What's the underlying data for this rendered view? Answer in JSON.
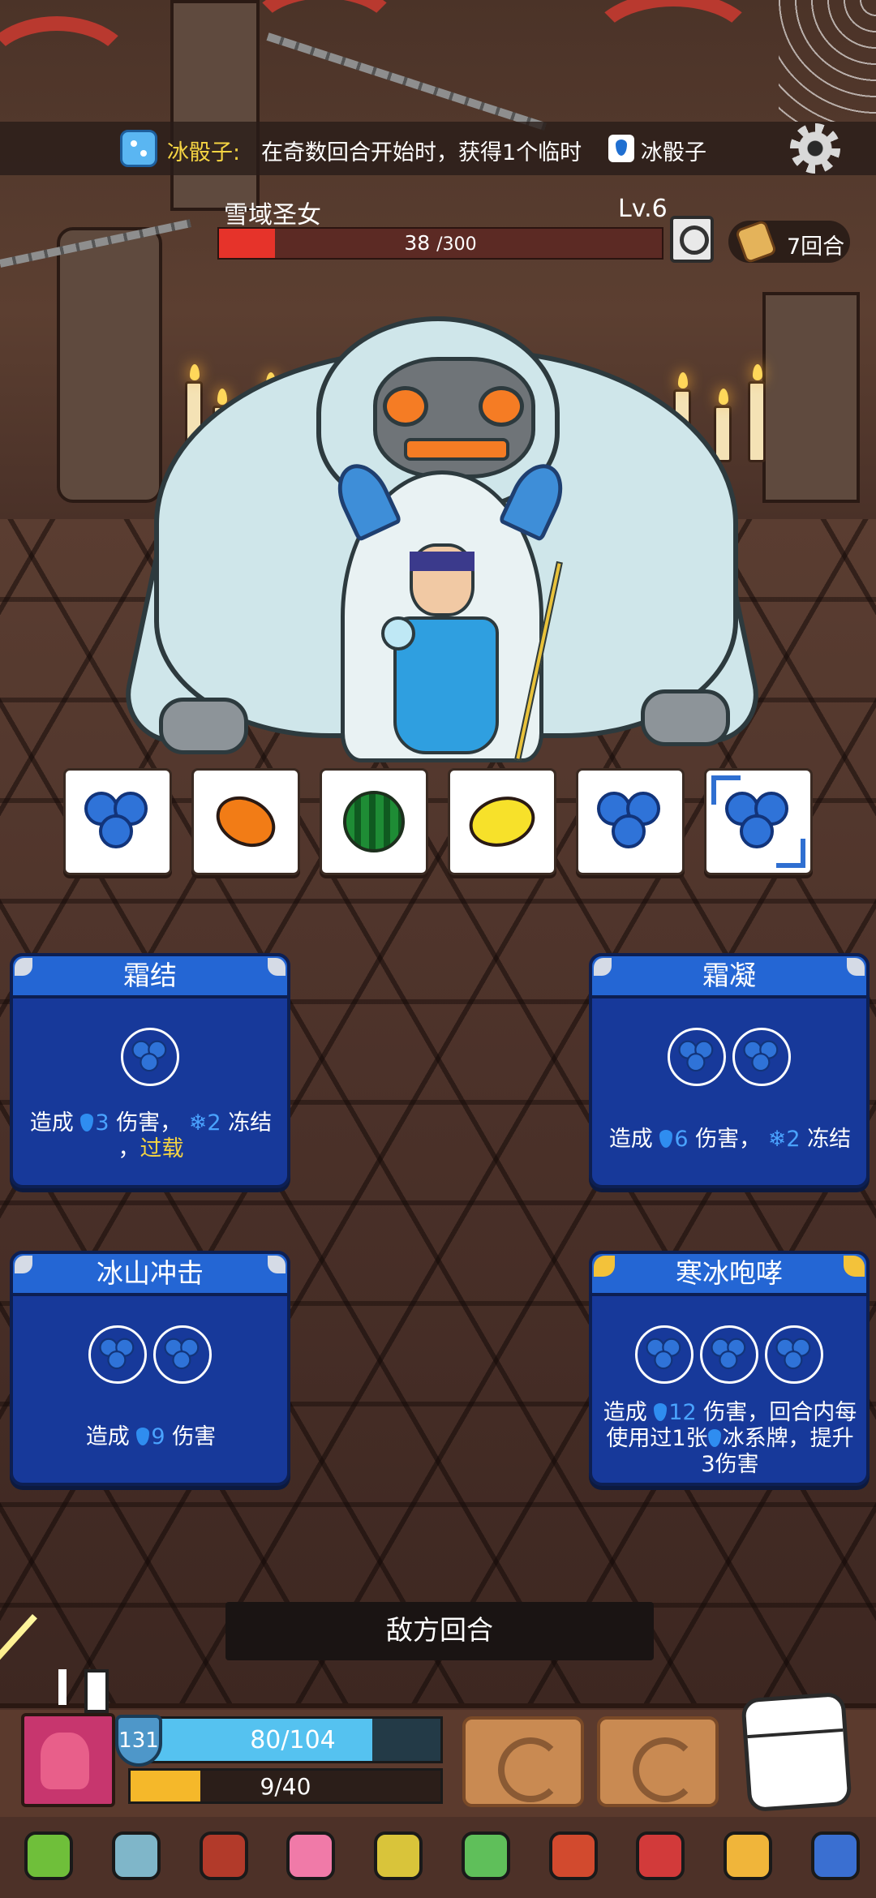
{
  "buff": {
    "name": "冰骰子:",
    "description": "在奇数回合开始时，获得1个临时",
    "tail": "冰骰子"
  },
  "enemy": {
    "name": "雪域圣女",
    "level": "Lv.6",
    "hp_current": "38",
    "hp_max": "/300",
    "hp_fraction": 0.127,
    "rounds": "7回合"
  },
  "dice": [
    {
      "face": "blueberry-icon"
    },
    {
      "face": "orange-icon"
    },
    {
      "face": "watermelon-icon"
    },
    {
      "face": "lemon-icon"
    },
    {
      "face": "blueberry-icon"
    },
    {
      "face": "blueberry-icon",
      "selected": true
    }
  ],
  "cards": [
    {
      "title": "霜结",
      "slots": 1,
      "desc_parts": {
        "a": "造成",
        "dmg": "3",
        "b": "伤害，",
        "freeze": "2",
        "c": "冻结",
        "d": "，",
        "overload": "过载"
      }
    },
    {
      "title": "霜凝",
      "slots": 2,
      "desc_parts": {
        "a": "造成",
        "dmg": "6",
        "b": "伤害，",
        "freeze": "2",
        "c": "冻结"
      }
    },
    {
      "title": "冰山冲击",
      "slots": 2,
      "desc_parts": {
        "a": "造成",
        "dmg": "9",
        "b": "伤害"
      }
    },
    {
      "title": "寒冰咆哮",
      "slots": 3,
      "desc_parts": {
        "a": "造成",
        "dmg": "12",
        "b": "伤害，回合内每使用过1张",
        "c": "冰系牌，提升3伤害"
      }
    }
  ],
  "turn_label": "敌方回合",
  "player": {
    "shield": "131",
    "hp": "80/104",
    "hp_fraction": 0.769,
    "energy": "9/40",
    "energy_fraction": 0.225
  },
  "relics": [
    "leaf-icon",
    "axe-icon",
    "hood-icon",
    "d20-icon",
    "armor-icon",
    "moss-icon",
    "helmet-icon",
    "gauntlet-icon",
    "goggles-icon",
    "scythe-icon"
  ],
  "colors": {
    "card_blue": "#17399a",
    "enemy_hp": "#e6332a",
    "player_hp": "#55c2f0",
    "energy": "#f5b82a",
    "highlight": "#f5d442"
  }
}
